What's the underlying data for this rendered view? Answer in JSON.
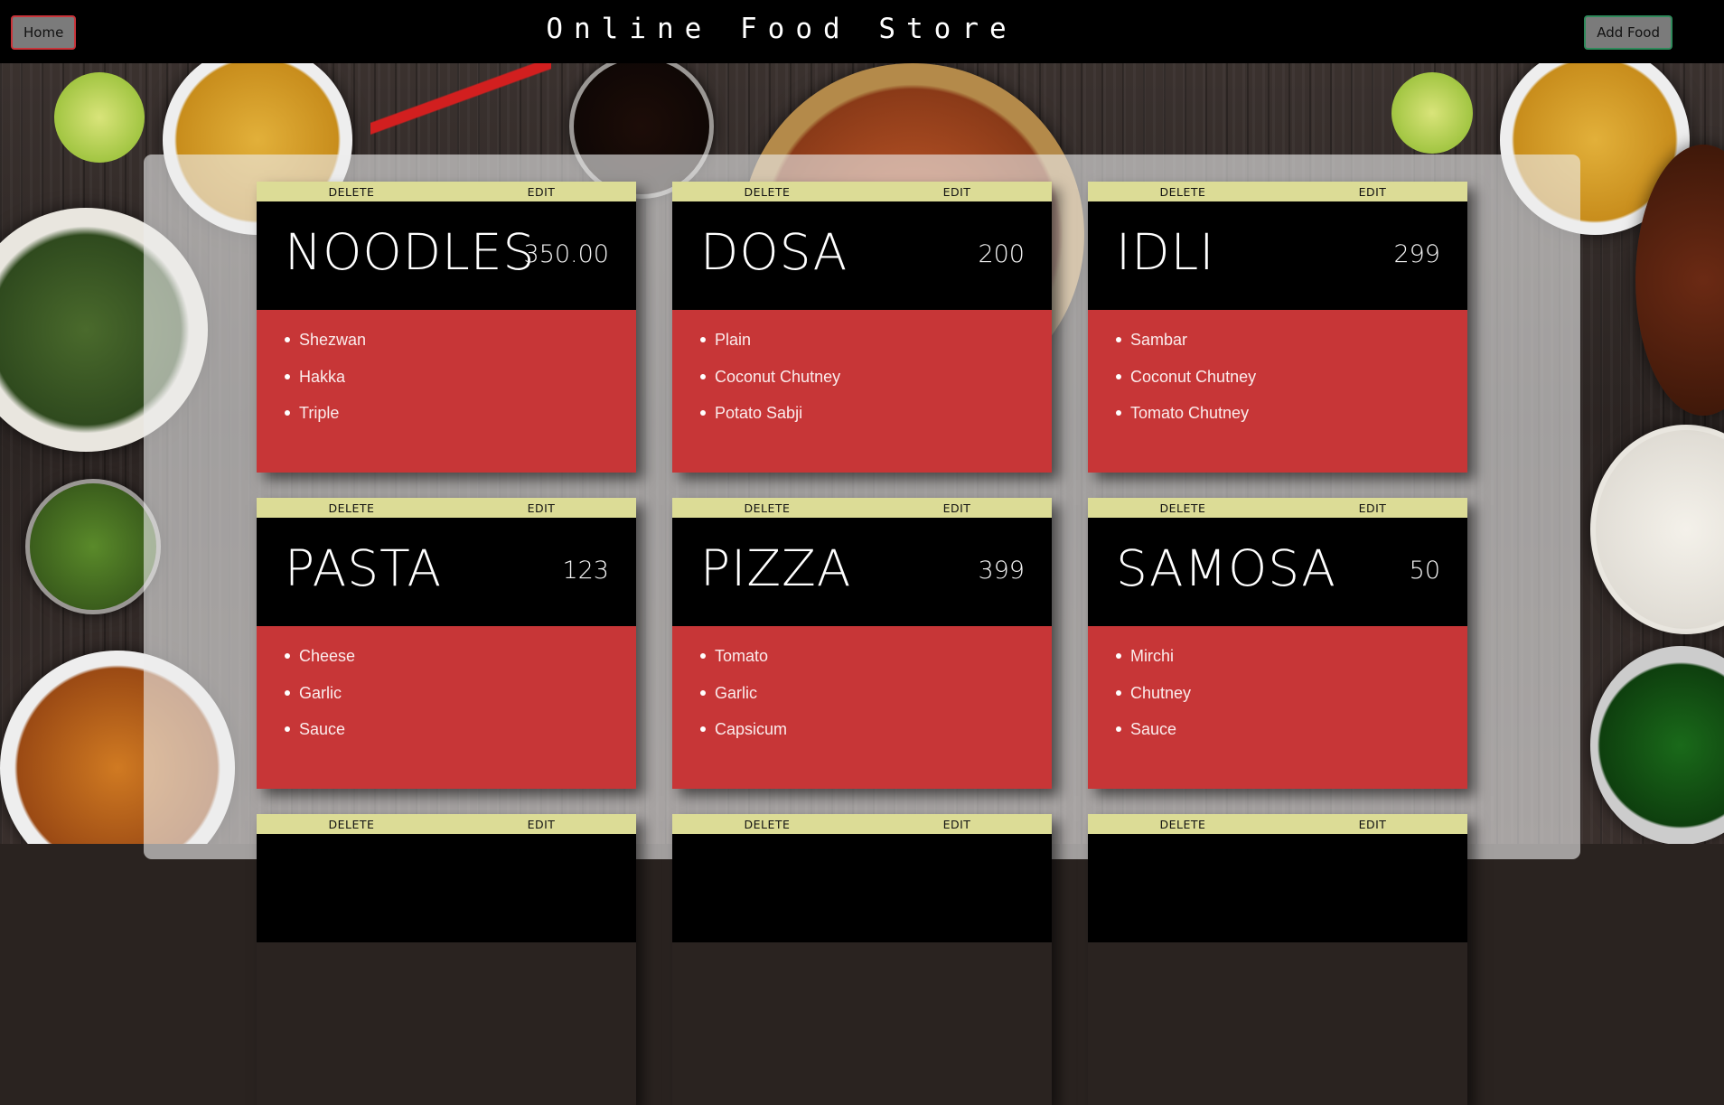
{
  "nav": {
    "home_label": "Home",
    "title": "Online Food Store",
    "add_food_label": "Add Food"
  },
  "card_actions": {
    "delete_label": "DELETE",
    "edit_label": "EDIT"
  },
  "foods": [
    {
      "name": "NOODLES",
      "price": "350.00",
      "ingredients": [
        "Shezwan",
        "Hakka",
        "Triple"
      ]
    },
    {
      "name": "DOSA",
      "price": "200",
      "ingredients": [
        "Plain",
        "Coconut Chutney",
        "Potato Sabji"
      ]
    },
    {
      "name": "IDLI",
      "price": "299",
      "ingredients": [
        "Sambar",
        "Coconut Chutney",
        "Tomato Chutney"
      ]
    },
    {
      "name": "PASTA",
      "price": "123",
      "ingredients": [
        "Cheese",
        "Garlic",
        "Sauce"
      ]
    },
    {
      "name": "PIZZA",
      "price": "399",
      "ingredients": [
        "Tomato",
        "Garlic",
        "Capsicum"
      ]
    },
    {
      "name": "SAMOSA",
      "price": "50",
      "ingredients": [
        "Mirchi",
        "Chutney",
        "Sauce"
      ]
    }
  ],
  "colors": {
    "topbar": "#000000",
    "card_actions": "#dcdc96",
    "card_header": "#000000",
    "card_body": "#c73637",
    "home_border": "#c9343a",
    "add_border": "#2f8a5b"
  }
}
